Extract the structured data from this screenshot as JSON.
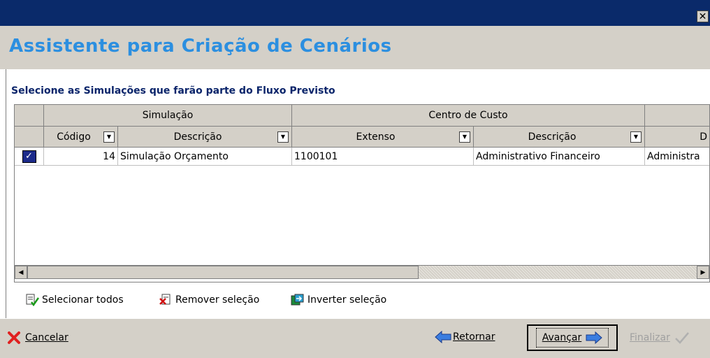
{
  "window": {
    "close_glyph": "✕"
  },
  "header": {
    "title": "Assistente para Criação de Cenários"
  },
  "section": {
    "title": "Selecione as Simulações que farão parte do Fluxo Previsto"
  },
  "grid": {
    "group_headers": {
      "simulacao": "Simulação",
      "centro_custo": "Centro de Custo"
    },
    "columns": {
      "codigo": "Código",
      "descricao": "Descrição",
      "extenso": "Extenso",
      "cc_descricao": "Descrição",
      "extra": "D"
    },
    "rows": [
      {
        "checked": true,
        "codigo": "14",
        "descricao": "Simulação Orçamento",
        "extenso": "1100101",
        "cc_descricao": "Administrativo Financeiro",
        "extra": "Administra"
      }
    ]
  },
  "actions": {
    "select_all": "Selecionar todos",
    "remove_selection": "Remover seleção",
    "invert_selection": "Inverter seleção"
  },
  "footer": {
    "cancel": "Cancelar",
    "back": "Retornar",
    "next": "Avançar",
    "finish": "Finalizar"
  },
  "colors": {
    "title_bar": "#0a2a6a",
    "header_title": "#2c8fe0",
    "section_title": "#0a246a",
    "panel": "#d4d0c8"
  }
}
